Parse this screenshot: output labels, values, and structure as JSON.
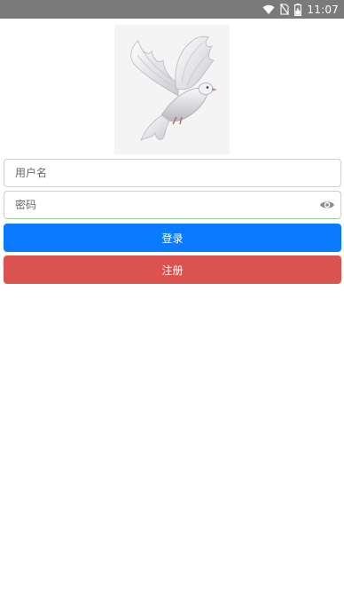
{
  "status_bar": {
    "time": "11:07",
    "icons": [
      "wifi-icon",
      "no-sim-icon",
      "battery-charging-icon"
    ]
  },
  "logo": {
    "icon": "dove-logo"
  },
  "form": {
    "username": {
      "placeholder": "用户名",
      "value": ""
    },
    "password": {
      "placeholder": "密码",
      "value": "",
      "toggle_icon": "eye-icon"
    }
  },
  "buttons": {
    "login_label": "登录",
    "register_label": "注册"
  },
  "colors": {
    "status_bar": "#7a7a7a",
    "login_button": "#0a7bff",
    "register_button": "#dc524e",
    "input_border": "#cfcfcf"
  }
}
